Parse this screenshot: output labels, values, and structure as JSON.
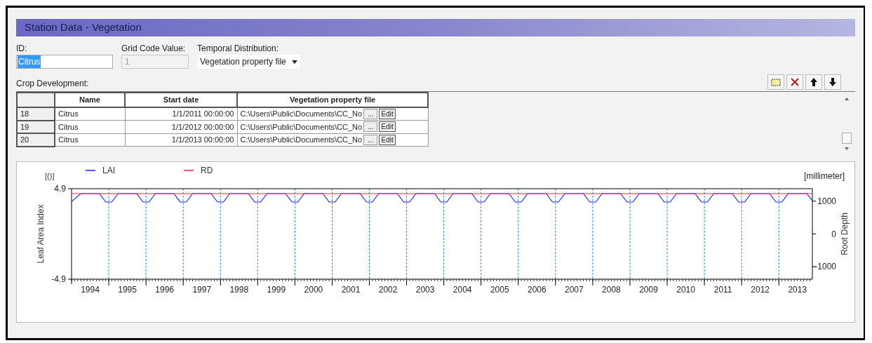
{
  "window": {
    "title": "Station Data - Vegetation"
  },
  "fields": {
    "id": {
      "label": "ID:",
      "value": "Citrus",
      "selected": true
    },
    "grid_code": {
      "label": "Grid Code Value:",
      "value": "1",
      "disabled": true
    },
    "temporal": {
      "label": "Temporal Distribution:",
      "value": "Vegetation property file"
    }
  },
  "crop_development": {
    "label": "Crop Development:",
    "columns": [
      "Name",
      "Start date",
      "Vegetation property file"
    ],
    "rows": [
      {
        "index": "18",
        "name": "Citrus",
        "start": "1/1/2011 00:00:00",
        "file": "C:\\Users\\Public\\Documents\\CC_No",
        "browse": "...",
        "edit": "Edit"
      },
      {
        "index": "19",
        "name": "Citrus",
        "start": "1/1/2012 00:00:00",
        "file": "C:\\Users\\Public\\Documents\\CC_No",
        "browse": "...",
        "edit": "Edit"
      },
      {
        "index": "20",
        "name": "Citrus",
        "start": "1/1/2013 00:00:00",
        "file": "C:\\Users\\Public\\Documents\\CC_No",
        "browse": "...",
        "edit": "Edit"
      }
    ]
  },
  "toolbar": [
    {
      "kind": "add"
    },
    {
      "kind": "delete"
    },
    {
      "kind": "up"
    },
    {
      "kind": "down"
    }
  ],
  "chart": {
    "unit": "[()]",
    "chart_data": {
      "type": "line",
      "ylabel": "Leaf Area Index",
      "ylim": [
        -4.9,
        4.9
      ],
      "yticks": [
        4.9,
        -4.9
      ],
      "xlim": [
        1994,
        2013.9
      ],
      "xticks": [
        {
          "value": 1994.5,
          "label": "1994"
        },
        {
          "value": 1995.5,
          "label": "1995"
        },
        {
          "value": 1996.5,
          "label": "1996"
        },
        {
          "value": 1997.5,
          "label": "1997"
        },
        {
          "value": 1998.5,
          "label": "1998"
        },
        {
          "value": 1999.5,
          "label": "1999"
        },
        {
          "value": 2000.5,
          "label": "2000"
        },
        {
          "value": 2001.5,
          "label": "2001"
        },
        {
          "value": 2002.5,
          "label": "2002"
        },
        {
          "value": 2003.5,
          "label": "2003"
        },
        {
          "value": 2004.5,
          "label": "2004"
        },
        {
          "value": 2005.5,
          "label": "2005"
        },
        {
          "value": 2006.5,
          "label": "2006"
        },
        {
          "value": 2007.5,
          "label": "2007"
        },
        {
          "value": 2008.5,
          "label": "2008"
        },
        {
          "value": 2009.5,
          "label": "2009"
        },
        {
          "value": 2010.5,
          "label": "2010"
        },
        {
          "value": 2011.5,
          "label": "2011"
        },
        {
          "value": 2012.5,
          "label": "2012"
        },
        {
          "value": 2013.5,
          "label": "2013"
        }
      ],
      "x": [
        1994,
        1994.25,
        1994.75,
        1994.92,
        1995.08,
        1995.25,
        1995.75,
        1995.92,
        1996.08,
        1996.25,
        1996.75,
        1996.92,
        1997.08,
        1997.25,
        1997.75,
        1997.92,
        1998.08,
        1998.25,
        1998.75,
        1998.92,
        1999.08,
        1999.25,
        1999.75,
        1999.92,
        2000.08,
        2000.25,
        2000.75,
        2000.92,
        2001.08,
        2001.25,
        2001.75,
        2001.92,
        2002.08,
        2002.25,
        2002.75,
        2002.92,
        2003.08,
        2003.25,
        2003.75,
        2003.92,
        2004.08,
        2004.25,
        2004.75,
        2004.92,
        2005.08,
        2005.25,
        2005.75,
        2005.92,
        2006.08,
        2006.25,
        2006.75,
        2006.92,
        2007.08,
        2007.25,
        2007.75,
        2007.92,
        2008.08,
        2008.25,
        2008.75,
        2008.92,
        2009.08,
        2009.25,
        2009.75,
        2009.92,
        2010.08,
        2010.25,
        2010.75,
        2010.92,
        2011.08,
        2011.25,
        2011.75,
        2011.92,
        2012.08,
        2012.25,
        2012.75,
        2012.92,
        2013.08,
        2013.25,
        2013.75,
        2013.9
      ],
      "series": [
        {
          "name": "LAI",
          "color": "#2020ff",
          "values": [
            3.5,
            4.37,
            4.37,
            3.46,
            3.46,
            4.37,
            4.37,
            3.46,
            3.46,
            4.37,
            4.37,
            3.46,
            3.46,
            4.37,
            4.37,
            3.46,
            3.46,
            4.37,
            4.37,
            3.46,
            3.46,
            4.37,
            4.37,
            3.46,
            3.46,
            4.37,
            4.37,
            3.46,
            3.46,
            4.37,
            4.37,
            3.46,
            3.46,
            4.37,
            4.37,
            3.46,
            3.46,
            4.37,
            4.37,
            3.46,
            3.46,
            4.37,
            4.37,
            3.46,
            3.46,
            4.37,
            4.37,
            3.46,
            3.46,
            4.37,
            4.37,
            3.46,
            3.46,
            4.37,
            4.37,
            3.46,
            3.46,
            4.37,
            4.37,
            3.46,
            3.46,
            4.37,
            4.37,
            3.46,
            3.46,
            4.37,
            4.37,
            3.46,
            3.46,
            4.37,
            4.37,
            3.46,
            3.46,
            4.37,
            4.37,
            3.46,
            3.46,
            4.37,
            4.37,
            3.6
          ]
        },
        {
          "name": "RD",
          "color": "#ff2040",
          "axis": "y2",
          "values": [
            1230,
            1230,
            1230,
            1230,
            1230,
            1230,
            1230,
            1230,
            1230,
            1230,
            1230,
            1230,
            1230,
            1230,
            1230,
            1230,
            1230,
            1230,
            1230,
            1230,
            1230,
            1230,
            1230,
            1230,
            1230,
            1230,
            1230,
            1230,
            1230,
            1230,
            1230,
            1230,
            1230,
            1230,
            1230,
            1230,
            1230,
            1230,
            1230,
            1230,
            1230,
            1230,
            1230,
            1230,
            1230,
            1230,
            1230,
            1230,
            1230,
            1230,
            1230,
            1230,
            1230,
            1230,
            1230,
            1230,
            1230,
            1230,
            1230,
            1230,
            1230,
            1230,
            1230,
            1230,
            1230,
            1230,
            1230,
            1230,
            1230,
            1230,
            1230,
            1230,
            1230,
            1230,
            1230,
            1230,
            1230,
            1230,
            1230,
            1230
          ]
        }
      ],
      "legend": "upper left",
      "ref_lines": [
        {
          "axis": "x",
          "value": 1995,
          "color": "#2a8ae0"
        },
        {
          "axis": "x",
          "value": 1996,
          "color": "#2a8ae0"
        },
        {
          "axis": "x",
          "value": 1997,
          "color": "#2a8ae0"
        },
        {
          "axis": "x",
          "value": 1998,
          "color": "#2a8ae0"
        },
        {
          "axis": "x",
          "value": 1999,
          "color": "#2a8ae0"
        },
        {
          "axis": "x",
          "value": 2000,
          "color": "#2a8ae0"
        },
        {
          "axis": "x",
          "value": 2001,
          "color": "#2a8ae0"
        },
        {
          "axis": "x",
          "value": 2002,
          "color": "#2a8ae0"
        },
        {
          "axis": "x",
          "value": 2003,
          "color": "#2a8ae0"
        },
        {
          "axis": "x",
          "value": 2004,
          "color": "#2a8ae0"
        },
        {
          "axis": "x",
          "value": 2005,
          "color": "#2a8ae0"
        },
        {
          "axis": "x",
          "value": 2006,
          "color": "#2a8ae0"
        },
        {
          "axis": "x",
          "value": 2007,
          "color": "#2a8ae0"
        },
        {
          "axis": "x",
          "value": 2008,
          "color": "#2a8ae0"
        },
        {
          "axis": "x",
          "value": 2009,
          "color": "#2a8ae0"
        },
        {
          "axis": "x",
          "value": 2010,
          "color": "#2a8ae0"
        },
        {
          "axis": "x",
          "value": 2011,
          "color": "#2a8ae0"
        },
        {
          "axis": "x",
          "value": 2012,
          "color": "#2a8ae0"
        },
        {
          "axis": "x",
          "value": 2013,
          "color": "#2a8ae0"
        }
      ],
      "y2label": "Root Depth",
      "y2lim": [
        -1380,
        1380
      ],
      "y2ticks": [
        1000,
        0,
        -1000
      ]
    },
    "right_unit": "[millimeter]"
  }
}
